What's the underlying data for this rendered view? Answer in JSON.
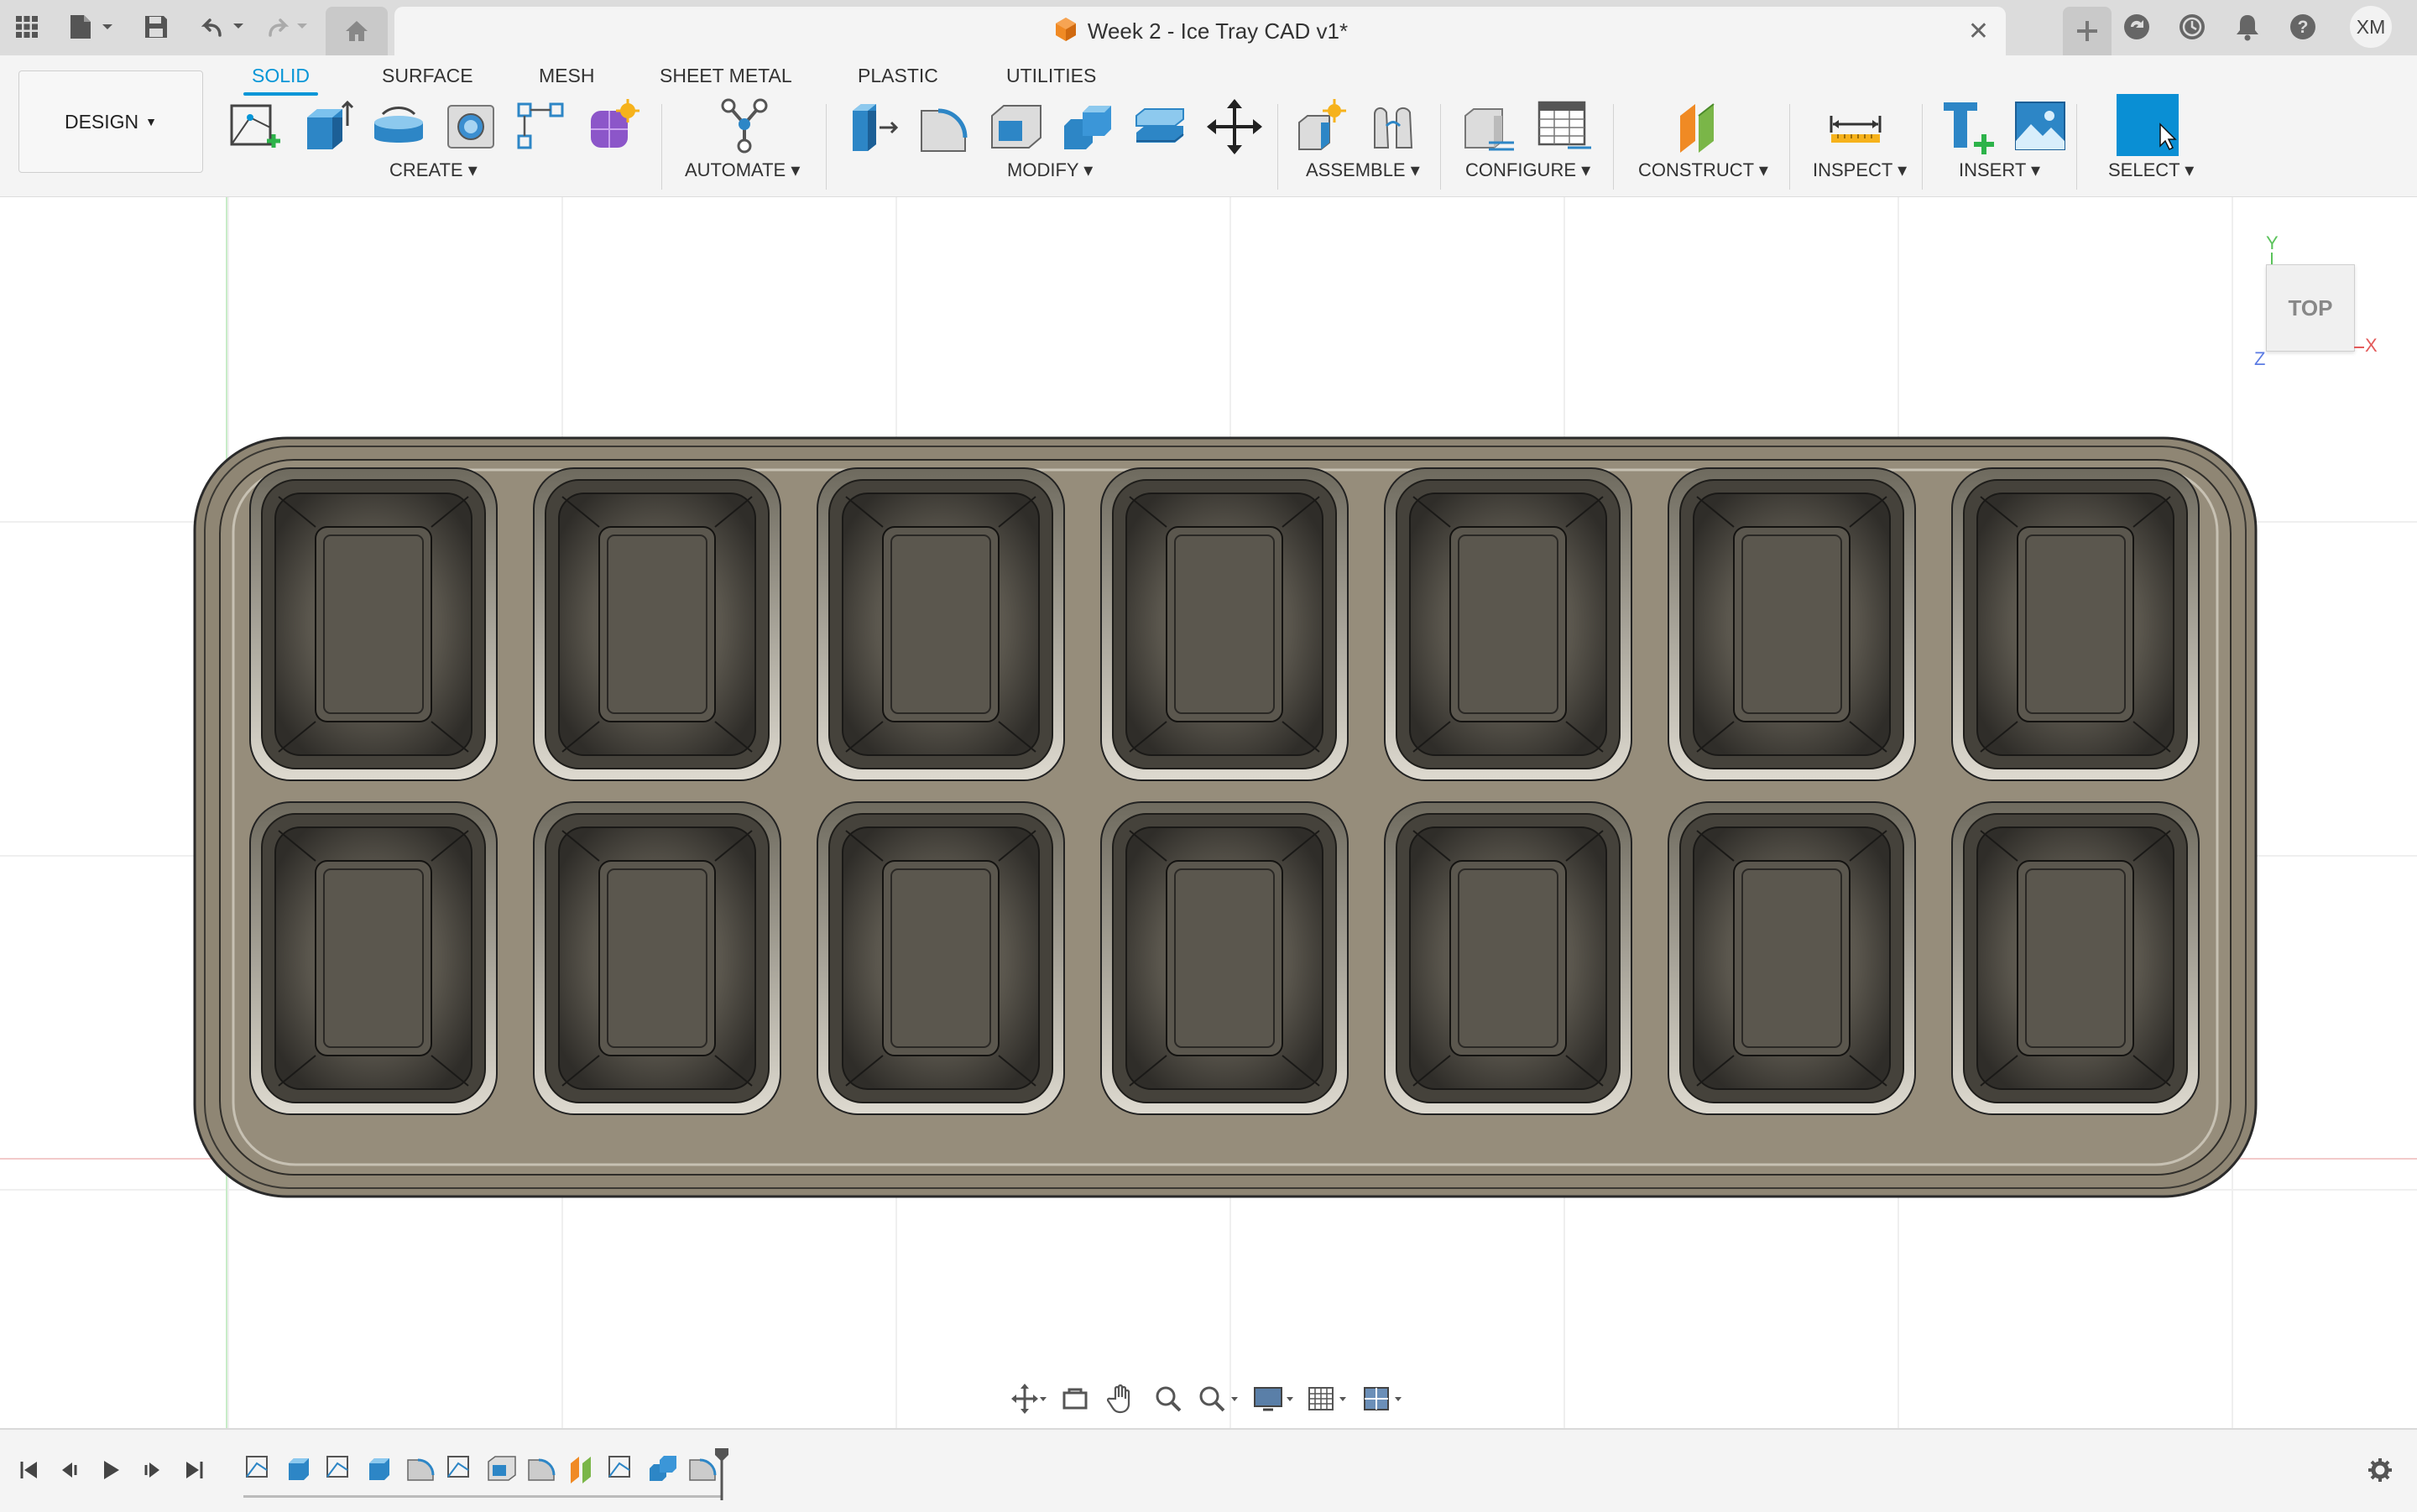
{
  "titlebar": {
    "document_title": "Week 2 - Ice Tray CAD v1*",
    "user_initials": "XM"
  },
  "ribbon": {
    "workspace_label": "DESIGN",
    "tabs": [
      {
        "label": "SOLID",
        "active": true
      },
      {
        "label": "SURFACE",
        "active": false
      },
      {
        "label": "MESH",
        "active": false
      },
      {
        "label": "SHEET METAL",
        "active": false
      },
      {
        "label": "PLASTIC",
        "active": false
      },
      {
        "label": "UTILITIES",
        "active": false
      }
    ],
    "groups": {
      "create": "CREATE",
      "automate": "AUTOMATE",
      "modify": "MODIFY",
      "assemble": "ASSEMBLE",
      "configure": "CONFIGURE",
      "construct": "CONSTRUCT",
      "inspect": "INSPECT",
      "insert": "INSERT",
      "select": "SELECT"
    }
  },
  "viewcube": {
    "face_label": "TOP",
    "axis_y": "Y",
    "axis_x": "X",
    "axis_z": "Z"
  },
  "model": {
    "name": "Ice Tray",
    "rows": 2,
    "columns": 7,
    "tray_color": "#8f8674",
    "cavity_color": "#4a4740"
  },
  "colors": {
    "accent": "#0696d7",
    "toolbar_bg": "#f4f4f4",
    "titlebar_bg": "#dcdcdc"
  },
  "timeline": {
    "feature_icons": [
      "sketch",
      "extrude",
      "sketch",
      "extrude",
      "fillet",
      "sketch",
      "shell",
      "fillet",
      "plane",
      "sketch",
      "combine",
      "fillet"
    ]
  }
}
